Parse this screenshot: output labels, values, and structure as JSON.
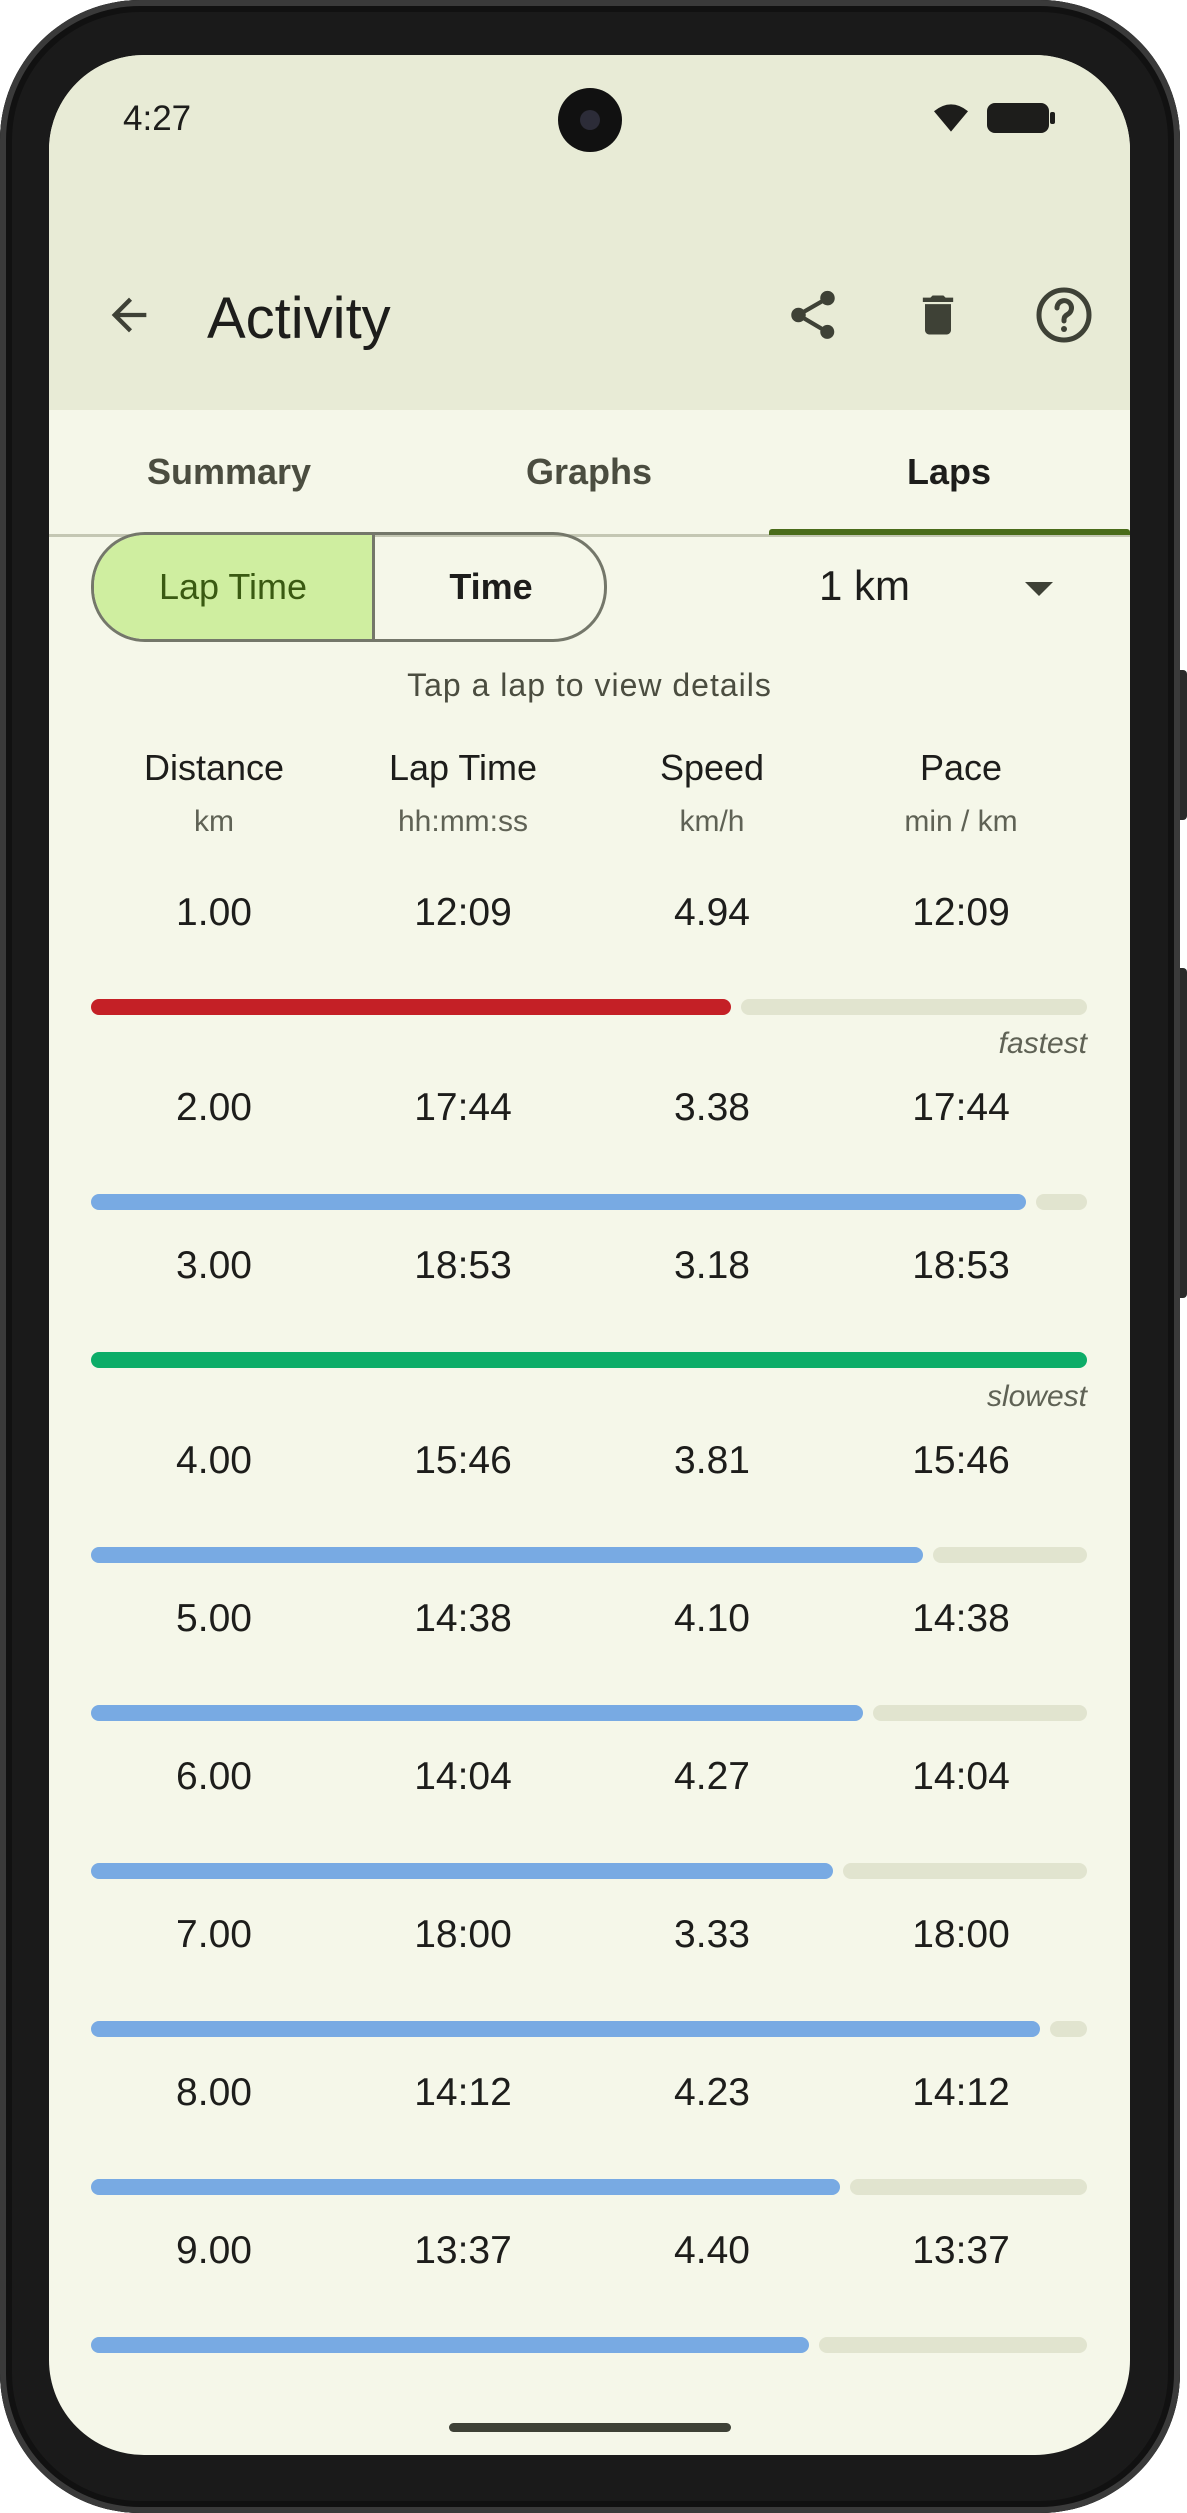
{
  "status": {
    "time": "4:27"
  },
  "appbar": {
    "title": "Activity"
  },
  "tabs": [
    {
      "label": "Summary",
      "active": false
    },
    {
      "label": "Graphs",
      "active": false
    },
    {
      "label": "Laps",
      "active": true
    }
  ],
  "toggle": {
    "lap_time": "Lap Time",
    "time": "Time",
    "selected": "Lap Time"
  },
  "lap_distance": {
    "value": "1 km"
  },
  "hint": "Tap a lap to view details",
  "columns": [
    {
      "label": "Distance",
      "unit": "km"
    },
    {
      "label": "Lap Time",
      "unit": "hh:mm:ss"
    },
    {
      "label": "Speed",
      "unit": "km/h"
    },
    {
      "label": "Pace",
      "unit": "min / km"
    }
  ],
  "laps": [
    {
      "distance": "1.00",
      "lap_time": "12:09",
      "speed": "4.94",
      "pace": "12:09",
      "bar_fraction": 0.643,
      "color": "#c42026",
      "tag": "fastest"
    },
    {
      "distance": "2.00",
      "lap_time": "17:44",
      "speed": "3.38",
      "pace": "17:44",
      "bar_fraction": 0.939,
      "color": "#78aae3",
      "tag": ""
    },
    {
      "distance": "3.00",
      "lap_time": "18:53",
      "speed": "3.18",
      "pace": "18:53",
      "bar_fraction": 1.0,
      "color": "#0cad68",
      "tag": "slowest"
    },
    {
      "distance": "4.00",
      "lap_time": "15:46",
      "speed": "3.81",
      "pace": "15:46",
      "bar_fraction": 0.835,
      "color": "#78aae3",
      "tag": ""
    },
    {
      "distance": "5.00",
      "lap_time": "14:38",
      "speed": "4.10",
      "pace": "14:38",
      "bar_fraction": 0.775,
      "color": "#78aae3",
      "tag": ""
    },
    {
      "distance": "6.00",
      "lap_time": "14:04",
      "speed": "4.27",
      "pace": "14:04",
      "bar_fraction": 0.745,
      "color": "#78aae3",
      "tag": ""
    },
    {
      "distance": "7.00",
      "lap_time": "18:00",
      "speed": "3.33",
      "pace": "18:00",
      "bar_fraction": 0.953,
      "color": "#78aae3",
      "tag": ""
    },
    {
      "distance": "8.00",
      "lap_time": "14:12",
      "speed": "4.23",
      "pace": "14:12",
      "bar_fraction": 0.752,
      "color": "#78aae3",
      "tag": ""
    },
    {
      "distance": "9.00",
      "lap_time": "13:37",
      "speed": "4.40",
      "pace": "13:37",
      "bar_fraction": 0.721,
      "color": "#78aae3",
      "tag": ""
    }
  ],
  "icons": {
    "back": "arrow-back-icon",
    "share": "share-icon",
    "delete": "delete-icon",
    "help": "help-icon",
    "dropdown": "dropdown-arrow-icon"
  }
}
